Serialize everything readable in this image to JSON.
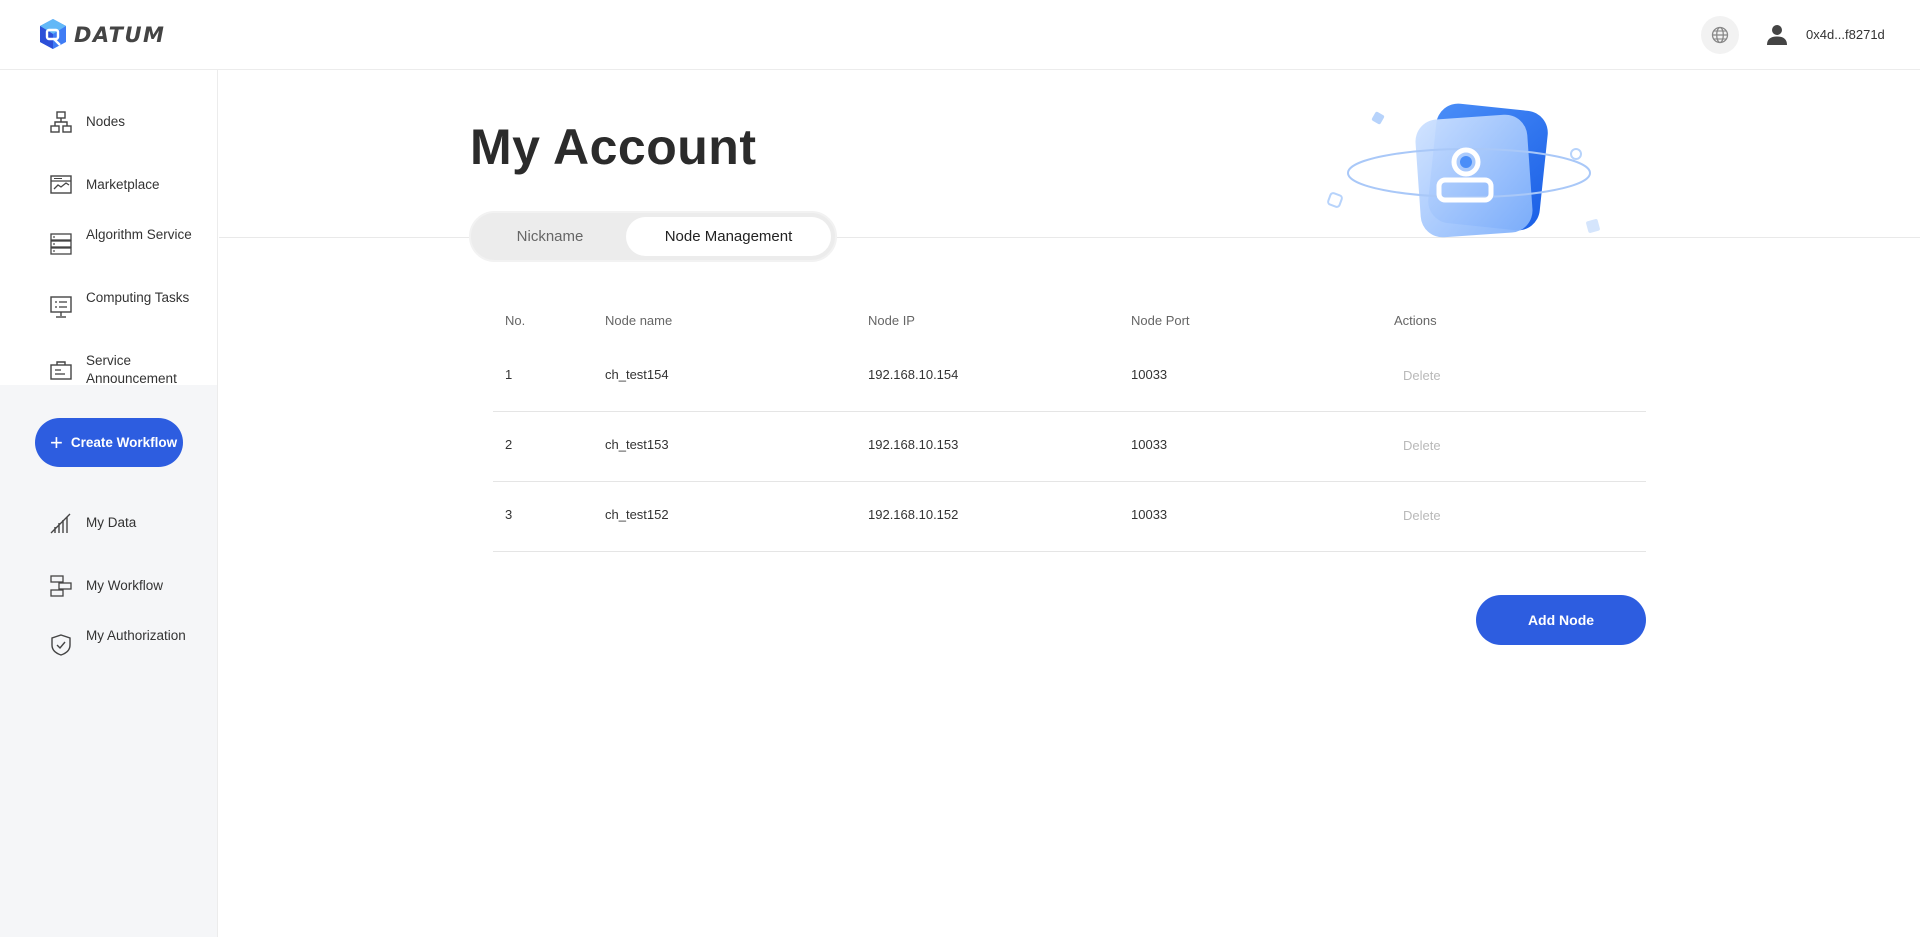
{
  "header": {
    "brand": "DATUM",
    "wallet_address": "0x4d...f8271d",
    "icons": {
      "language": "globe-icon",
      "user": "user-icon"
    }
  },
  "sidebar": {
    "top_items": [
      {
        "label": "Nodes",
        "icon": "nodes-icon"
      },
      {
        "label": "Marketplace",
        "icon": "marketplace-icon"
      },
      {
        "label": "Algorithm Service",
        "icon": "algorithm-icon"
      },
      {
        "label": "Computing Tasks",
        "icon": "computing-icon"
      },
      {
        "label": "Service Announcement",
        "icon": "announcement-icon"
      }
    ],
    "create_button": "Create Workflow",
    "bottom_items": [
      {
        "label": "My Data",
        "icon": "data-icon"
      },
      {
        "label": "My Workflow",
        "icon": "workflow-icon"
      },
      {
        "label": "My Authorization",
        "icon": "authorization-icon"
      }
    ]
  },
  "main": {
    "title": "My Account",
    "tabs": [
      {
        "label": "Nickname",
        "active": false
      },
      {
        "label": "Node Management",
        "active": true
      }
    ],
    "table": {
      "columns": [
        "No.",
        "Node name",
        "Node IP",
        "Node Port",
        "Actions"
      ],
      "rows": [
        {
          "no": "1",
          "name": "ch_test154",
          "ip": "192.168.10.154",
          "port": "10033",
          "action": "Delete"
        },
        {
          "no": "2",
          "name": "ch_test153",
          "ip": "192.168.10.153",
          "port": "10033",
          "action": "Delete"
        },
        {
          "no": "3",
          "name": "ch_test152",
          "ip": "192.168.10.152",
          "port": "10033",
          "action": "Delete"
        }
      ]
    },
    "add_button": "Add Node"
  },
  "colors": {
    "accent": "#2d5de0",
    "muted": "#b9b9b9",
    "sidebar_bg": "#f5f6f8"
  }
}
